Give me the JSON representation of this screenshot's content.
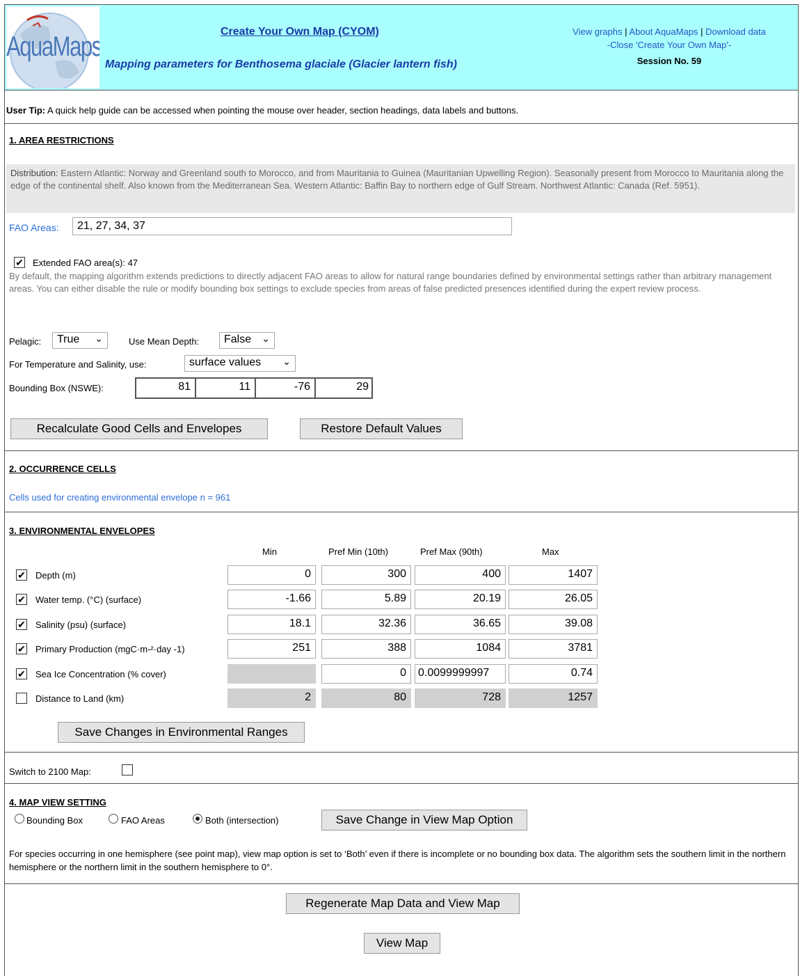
{
  "header": {
    "logo_text": "AquaMaps",
    "cyom_title": "Create Your Own Map (CYOM)",
    "mapping_title": "Mapping parameters for Benthosema glaciale (Glacier lantern fish)",
    "links": {
      "view_graphs": "View graphs",
      "about": "About AquaMaps",
      "download": "Download data",
      "sep": "|"
    },
    "close_link": "-Close 'Create Your Own Map'-",
    "session": "Session No. 59"
  },
  "tip": {
    "label": "User Tip:",
    "text": " A quick help guide can be accessed when pointing the mouse over header, section headings, data labels and buttons."
  },
  "area": {
    "heading": "1. AREA RESTRICTIONS",
    "dist_label": "Distribution:",
    "dist_text": " Eastern Atlantic: Norway and Greenland south to Morocco, and from Mauritania to Guinea (Mauritanian Upwelling Region). Seasonally present from Morocco to Mauritania along the edge of the continental shelf. Also known from the Mediterranean Sea. Western Atlantic: Baffin Bay to northern edge of Gulf Stream. Northwest Atlantic: Canada (Ref. 5951).",
    "fao_label": "FAO Areas:",
    "fao_value": "21, 27, 34, 37",
    "extended_label": "Extended FAO area(s): 47",
    "extended_checked": true,
    "extended_desc": "By default, the mapping algorithm extends predictions to directly adjacent FAO areas to allow for natural range boundaries defined by environmental settings rather than arbitrary management areas. You can either disable the rule or modify bounding box settings to exclude species from areas of false predicted presences identified during the expert review process.",
    "pelagic_label": "Pelagic:",
    "pelagic_value": "True",
    "mean_depth_label": "Use Mean Depth:",
    "mean_depth_value": "False",
    "ts_label": "For Temperature and Salinity, use:",
    "ts_value": "surface values",
    "bbox_label": "Bounding Box (NSWE):",
    "bbox": {
      "n": "81",
      "s": "11",
      "w": "-76",
      "e": "29"
    },
    "recalc_button": "Recalculate Good Cells and Envelopes",
    "restore_button": "Restore Default Values"
  },
  "occurrence": {
    "heading": "2. OCCURRENCE CELLS",
    "text": "Cells used for creating environmental envelope  n = 961"
  },
  "envelopes": {
    "heading": "3. ENVIRONMENTAL ENVELOPES",
    "cols": {
      "min": "Min",
      "pmin": "Pref Min (10th)",
      "pmax": "Pref Max (90th)",
      "max": "Max"
    },
    "rows": [
      {
        "label": "Depth (m)",
        "checked": true,
        "min": "0",
        "pmin": "300",
        "pmax": "400",
        "max": "1407"
      },
      {
        "label": "Water temp. (°C) (surface)",
        "checked": true,
        "min": "-1.66",
        "pmin": "5.89",
        "pmax": "20.19",
        "max": "26.05"
      },
      {
        "label": "Salinity (psu) (surface)",
        "checked": true,
        "min": "18.1",
        "pmin": "32.36",
        "pmax": "36.65",
        "max": "39.08"
      },
      {
        "label": "Primary Production (mgC·m-²·day -1)",
        "checked": true,
        "min": "251",
        "pmin": "388",
        "pmax": "1084",
        "max": "3781"
      },
      {
        "label": "Sea Ice Concentration (% cover)",
        "checked": true,
        "min": "",
        "pmin": "0",
        "pmax": "0.0099999997",
        "max": "0.74"
      },
      {
        "label": "Distance to Land (km)",
        "checked": false,
        "min": "2",
        "pmin": "80",
        "pmax": "728",
        "max": "1257"
      }
    ],
    "save_button": "Save Changes in Environmental Ranges"
  },
  "switch": {
    "label": "Switch to 2100 Map:",
    "checked": false
  },
  "mapview": {
    "heading": "4. MAP VIEW SETTING",
    "options": [
      "Bounding Box",
      "FAO Areas",
      "Both (intersection)"
    ],
    "selected": "Both (intersection)",
    "save_button": "Save Change in View Map Option",
    "note": "For species occurring in one hemisphere (see point map), view map option is set to ‘Both’ even if there is incomplete or no bounding box data. The algorithm sets the southern limit in the northern hemisphere or the northern limit in the southern hemisphere to 0°."
  },
  "footer": {
    "regen_button": "Regenerate Map Data and View Map",
    "view_button": "View Map"
  }
}
